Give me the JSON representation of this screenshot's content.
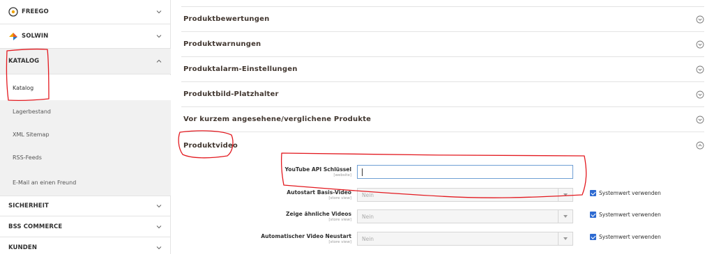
{
  "sidebar": {
    "sections": [
      {
        "label": "FREEGO",
        "icon": "freego-logo-icon",
        "expanded": false
      },
      {
        "label": "SOLWIN",
        "icon": "solwin-logo-icon",
        "expanded": false
      },
      {
        "label": "KATALOG",
        "expanded": true
      },
      {
        "label": "SICHERHEIT",
        "expanded": false
      },
      {
        "label": "BSS COMMERCE",
        "expanded": false
      },
      {
        "label": "KUNDEN",
        "expanded": false
      }
    ],
    "katalog_items": [
      {
        "label": "Katalog",
        "active": true
      },
      {
        "label": "Lagerbestand",
        "active": false
      },
      {
        "label": "XML Sitemap",
        "active": false
      },
      {
        "label": "RSS-Feeds",
        "active": false
      },
      {
        "label": "E-Mail an einen Freund",
        "active": false
      }
    ]
  },
  "main": {
    "groups": [
      {
        "label": "Produktbewertungen",
        "expanded": false
      },
      {
        "label": "Produktwarnungen",
        "expanded": false
      },
      {
        "label": "Produktalarm-Einstellungen",
        "expanded": false
      },
      {
        "label": "Produktbild-Platzhalter",
        "expanded": false
      },
      {
        "label": "Vor kurzem angesehene/verglichene Produkte",
        "expanded": false
      },
      {
        "label": "Produktvideo",
        "expanded": true
      }
    ],
    "fields": [
      {
        "label": "YouTube API Schlüssel",
        "scope": "[website]",
        "type": "text",
        "value": ""
      },
      {
        "label": "Autostart Basis-Video",
        "scope": "[store view]",
        "type": "select",
        "value": "Nein",
        "use_system": "Systemwert verwenden"
      },
      {
        "label": "Zeige ähnliche Videos",
        "scope": "[store view]",
        "type": "select",
        "value": "Nein",
        "use_system": "Systemwert verwenden"
      },
      {
        "label": "Automatischer Video Neustart",
        "scope": "[store view]",
        "type": "select",
        "value": "Nein",
        "use_system": "Systemwert verwenden"
      }
    ]
  },
  "colors": {
    "annotation": "#e3191f",
    "checkbox": "#2d6ad1",
    "input_focus_border": "#6e9fd4"
  }
}
